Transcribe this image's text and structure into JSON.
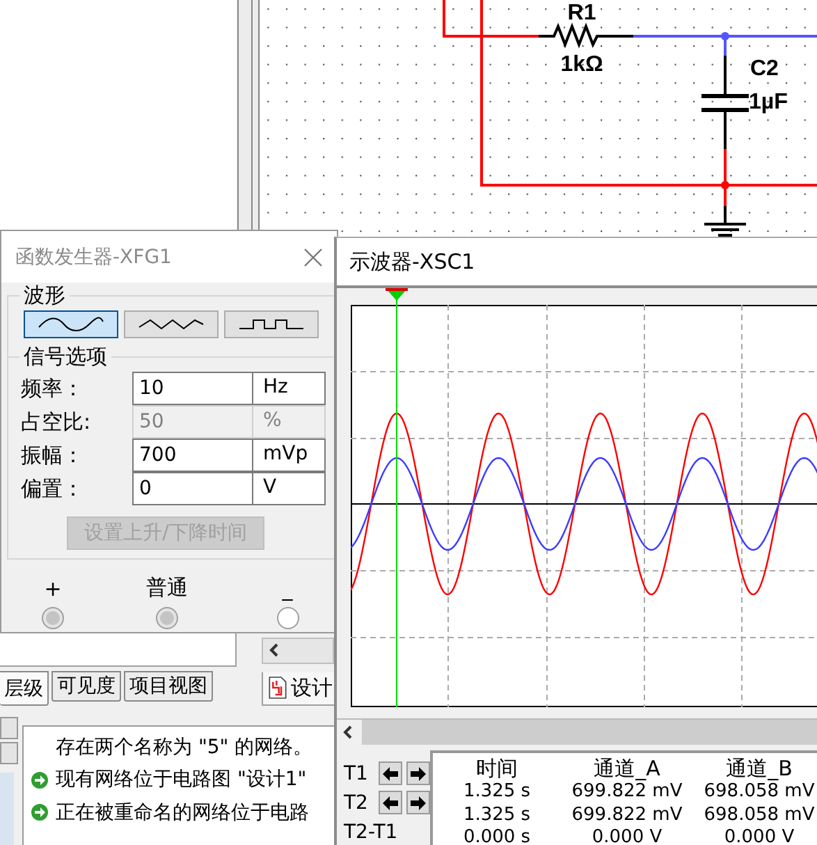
{
  "schematic": {
    "resistor": {
      "name": "R1",
      "value": "1kΩ"
    },
    "capacitor": {
      "name": "C2",
      "value": "1µF"
    }
  },
  "function_generator": {
    "title": "函数发生器-XFG1",
    "waveform_group": "波形",
    "waveforms": [
      {
        "kind": "sine",
        "selected": true
      },
      {
        "kind": "triangle",
        "selected": false
      },
      {
        "kind": "square",
        "selected": false
      }
    ],
    "options_group": "信号选项",
    "fields": [
      {
        "label": "频率：",
        "value": "10",
        "unit": "Hz",
        "disabled": false
      },
      {
        "label": "占空比:",
        "value": "50",
        "unit": "%",
        "disabled": true
      },
      {
        "label": "振幅：",
        "value": "700",
        "unit": "mVp",
        "disabled": false
      },
      {
        "label": "偏置：",
        "value": "0",
        "unit": "V",
        "disabled": false
      }
    ],
    "rise_fall_button": {
      "label": "设置上升/下降时间",
      "disabled": true
    },
    "terminals": [
      {
        "label": "+",
        "connected": true
      },
      {
        "label": "普通",
        "connected": true
      },
      {
        "label": "_",
        "connected": false
      }
    ]
  },
  "design_toolbox": {
    "tabs": [
      {
        "label": "层级",
        "selected": true
      },
      {
        "label": "可见度",
        "selected": false
      },
      {
        "label": "项目视图",
        "selected": false
      }
    ]
  },
  "design_tab": {
    "label": "设计"
  },
  "messages": [
    {
      "kind": "plain",
      "text": "存在两个名称为 \"5\" 的网络。"
    },
    {
      "kind": "info",
      "text": "现有网络位于电路图 \"设计1\""
    },
    {
      "kind": "info",
      "text": "正在被重命名的网络位于电路"
    }
  ],
  "oscilloscope": {
    "title": "示波器-XSC1",
    "traces": [
      {
        "color": "#ff0000"
      },
      {
        "color": "#3c3cff"
      }
    ],
    "columns": [
      "时间",
      "通道_A",
      "通道_B"
    ],
    "rows": [
      {
        "kind": "cursor",
        "label": "T1",
        "cells": [
          "1.325 s",
          "699.822 mV",
          "698.058 mV"
        ]
      },
      {
        "kind": "cursor",
        "label": "T2",
        "cells": [
          "1.325 s",
          "699.822 mV",
          "698.058 mV"
        ]
      },
      {
        "kind": "difference",
        "label": "T2-T1",
        "cells": [
          "0.000 s",
          "0.000 V",
          "0.000 V"
        ]
      }
    ]
  }
}
